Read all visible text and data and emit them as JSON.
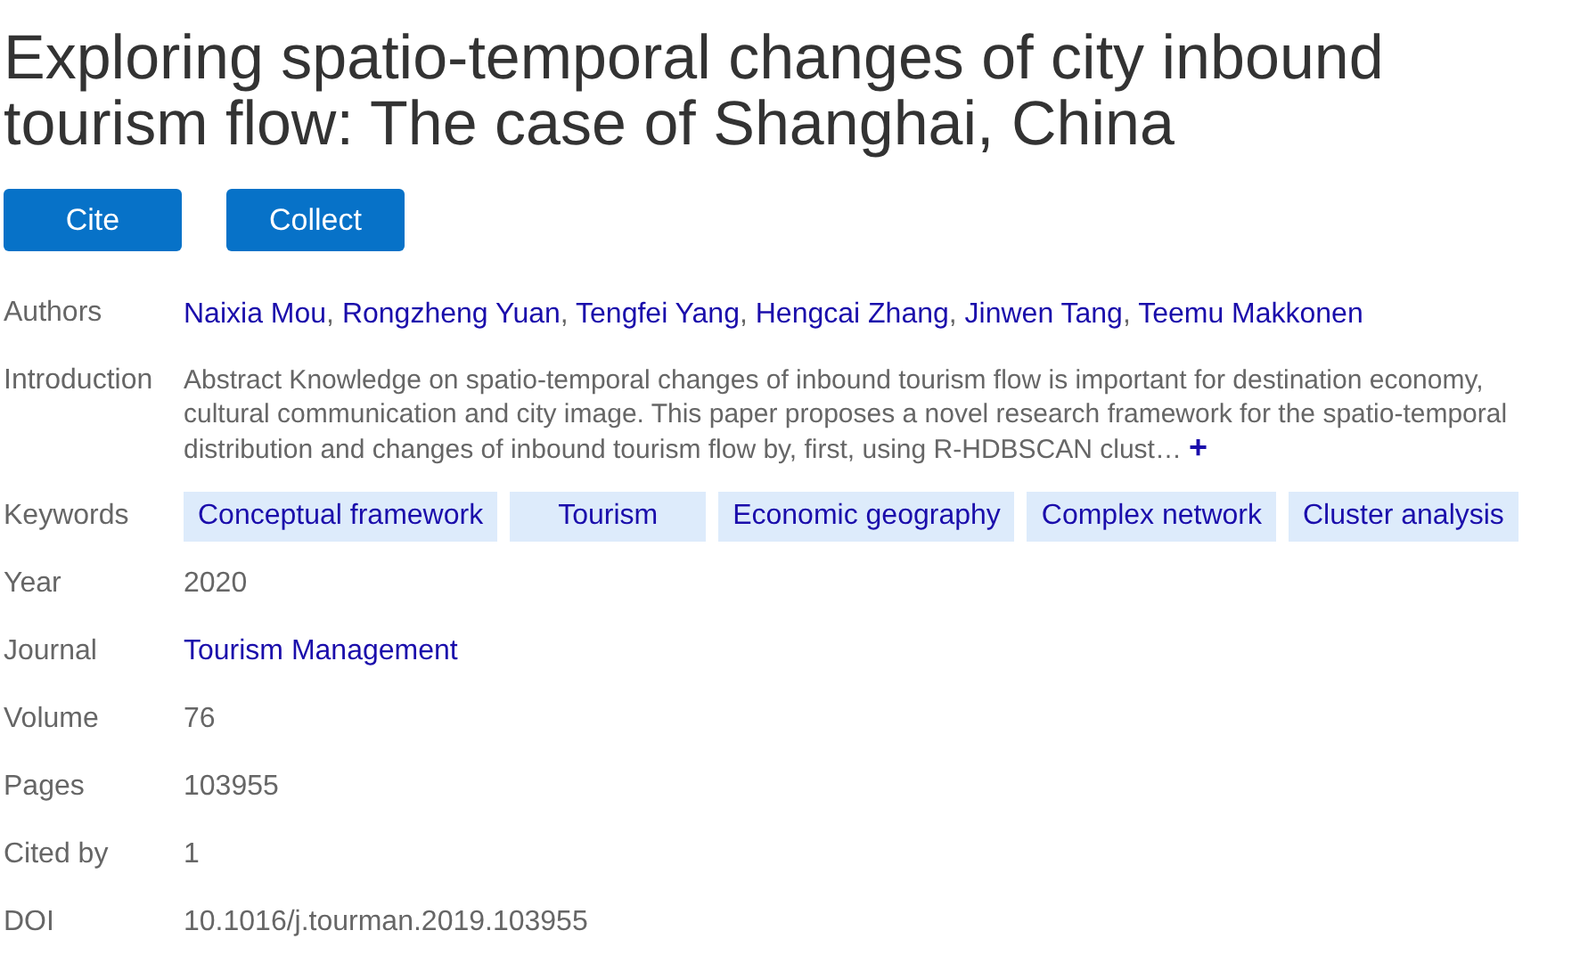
{
  "title": "Exploring spatio-temporal changes of city inbound tourism flow: The case of Shanghai, China",
  "buttons": [
    "Cite",
    "Collect"
  ],
  "fields": [
    {
      "kind": "links",
      "label": "Authors",
      "separator": ",",
      "items": [
        "Naixia Mou",
        "Rongzheng Yuan",
        "Tengfei Yang",
        "Hengcai Zhang",
        "Jinwen Tang",
        "Teemu Makkonen"
      ]
    },
    {
      "kind": "abstract",
      "label": "Introduction",
      "value": "Abstract Knowledge on spatio-temporal changes of inbound tourism flow is important for destination economy, cultural communication and city image. This paper proposes a novel research framework for the spatio-temporal distribution and changes of inbound tourism flow by, first, using R-HDBSCAN clust…",
      "expand": "+"
    },
    {
      "kind": "tags",
      "label": "Keywords",
      "items": [
        "Conceptual framework",
        "Tourism",
        "Economic geography",
        "Complex network",
        "Cluster analysis"
      ]
    },
    {
      "kind": "text",
      "label": "Year",
      "value": "2020"
    },
    {
      "kind": "link",
      "label": "Journal",
      "value": "Tourism Management"
    },
    {
      "kind": "text",
      "label": "Volume",
      "value": "76"
    },
    {
      "kind": "text",
      "label": "Pages",
      "value": "103955"
    },
    {
      "kind": "text",
      "label": "Cited by",
      "value": "1"
    },
    {
      "kind": "text",
      "label": "DOI",
      "value": "10.1016/j.tourman.2019.103955"
    }
  ]
}
